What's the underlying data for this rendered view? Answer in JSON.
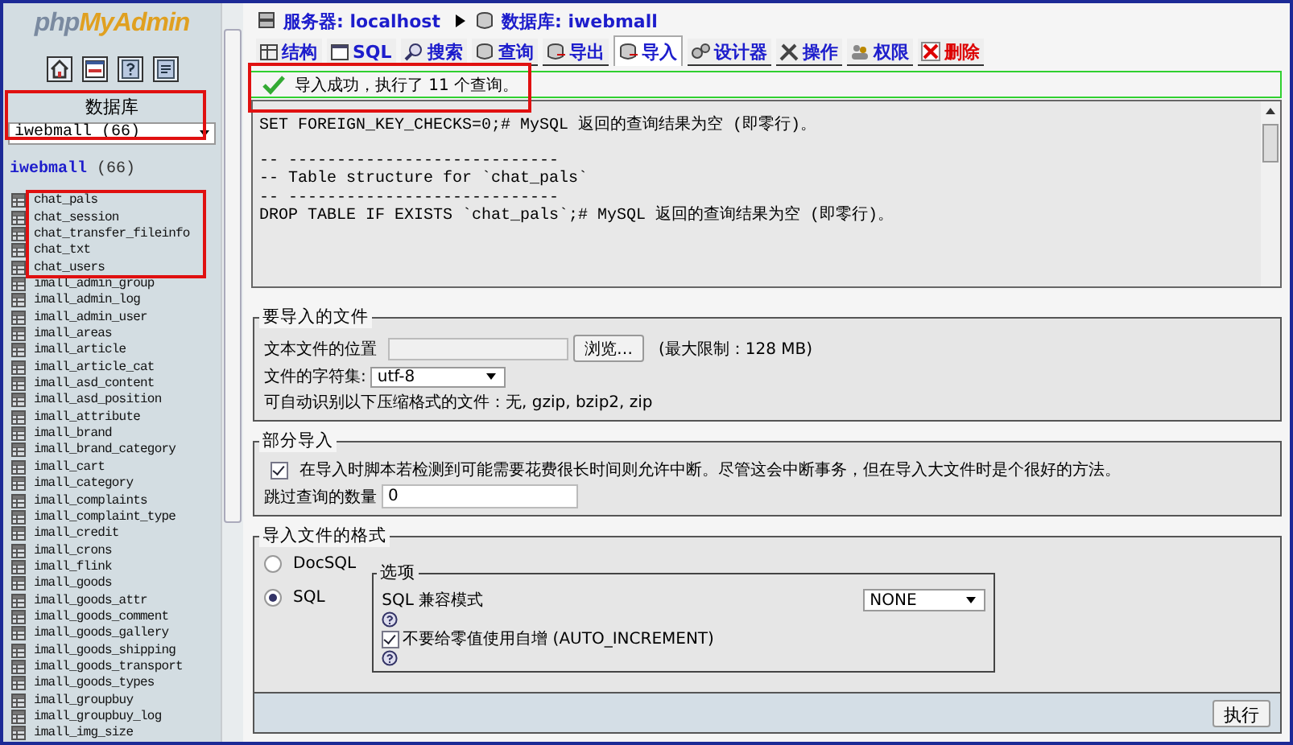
{
  "logo": {
    "prefix": "php",
    "name": "MyAdmin"
  },
  "sidebar": {
    "db_label": "数据库",
    "db_select": "iwebmall (66)",
    "db_link": {
      "name": "iwebmall",
      "count": "(66)"
    },
    "tables": [
      "chat_pals",
      "chat_session",
      "chat_transfer_fileinfo",
      "chat_txt",
      "chat_users",
      "imall_admin_group",
      "imall_admin_log",
      "imall_admin_user",
      "imall_areas",
      "imall_article",
      "imall_article_cat",
      "imall_asd_content",
      "imall_asd_position",
      "imall_attribute",
      "imall_brand",
      "imall_brand_category",
      "imall_cart",
      "imall_category",
      "imall_complaints",
      "imall_complaint_type",
      "imall_credit",
      "imall_crons",
      "imall_flink",
      "imall_goods",
      "imall_goods_attr",
      "imall_goods_comment",
      "imall_goods_gallery",
      "imall_goods_shipping",
      "imall_goods_transport",
      "imall_goods_types",
      "imall_groupbuy",
      "imall_groupbuy_log",
      "imall_img_size"
    ]
  },
  "breadcrumb": [
    {
      "label": "服务器:",
      "value": "localhost"
    },
    {
      "label": "数据库:",
      "value": "iwebmall"
    }
  ],
  "tabs": [
    {
      "label": "结构",
      "selected": false,
      "kind": "normal"
    },
    {
      "label": "SQL",
      "selected": false,
      "kind": "normal"
    },
    {
      "label": "搜索",
      "selected": false,
      "kind": "normal"
    },
    {
      "label": "查询",
      "selected": false,
      "kind": "normal"
    },
    {
      "label": "导出",
      "selected": false,
      "kind": "normal"
    },
    {
      "label": "导入",
      "selected": true,
      "kind": "normal"
    },
    {
      "label": "设计器",
      "selected": false,
      "kind": "normal"
    },
    {
      "label": "操作",
      "selected": false,
      "kind": "normal"
    },
    {
      "label": "权限",
      "selected": false,
      "kind": "normal"
    },
    {
      "label": "删除",
      "selected": false,
      "kind": "danger"
    }
  ],
  "message": {
    "text": "导入成功，执行了 11 个查询。"
  },
  "sql_output": {
    "blocks": [
      [
        "SET FOREIGN_KEY_CHECKS=0;# MySQL 返回的查询结果为空 (即零行)。"
      ],
      [
        "-- ----------------------------",
        "-- Table structure for `chat_pals`",
        "-- ----------------------------",
        "DROP TABLE IF EXISTS `chat_pals`;# MySQL 返回的查询结果为空 (即零行)。"
      ]
    ]
  },
  "file_section": {
    "legend": "要导入的文件",
    "location_label": "文本文件的位置",
    "browse_button": "浏览…",
    "limit": "(最大限制：128 MB)",
    "charset_label": "文件的字符集:",
    "charset_value": "utf-8",
    "compression_note": "可自动识别以下压缩格式的文件：无, gzip, bzip2, zip"
  },
  "partial_section": {
    "legend": "部分导入",
    "allow_interrupt": {
      "label": "在导入时脚本若检测到可能需要花费很长时间则允许中断。尽管这会中断事务，但在导入大文件时是个很好的方法。",
      "checked": true
    },
    "skip_label": "跳过查询的数量",
    "skip_value": "0"
  },
  "format_section": {
    "legend": "导入文件的格式",
    "formats": [
      {
        "label": "DocSQL",
        "selected": false
      },
      {
        "label": "SQL",
        "selected": true
      }
    ],
    "options": {
      "legend": "选项",
      "compat_label": "SQL 兼容模式",
      "compat_value": "NONE",
      "no_auto_value": {
        "label": "不要给零值使用自增 (AUTO_INCREMENT)",
        "checked": true
      }
    }
  },
  "go_button": "执行"
}
